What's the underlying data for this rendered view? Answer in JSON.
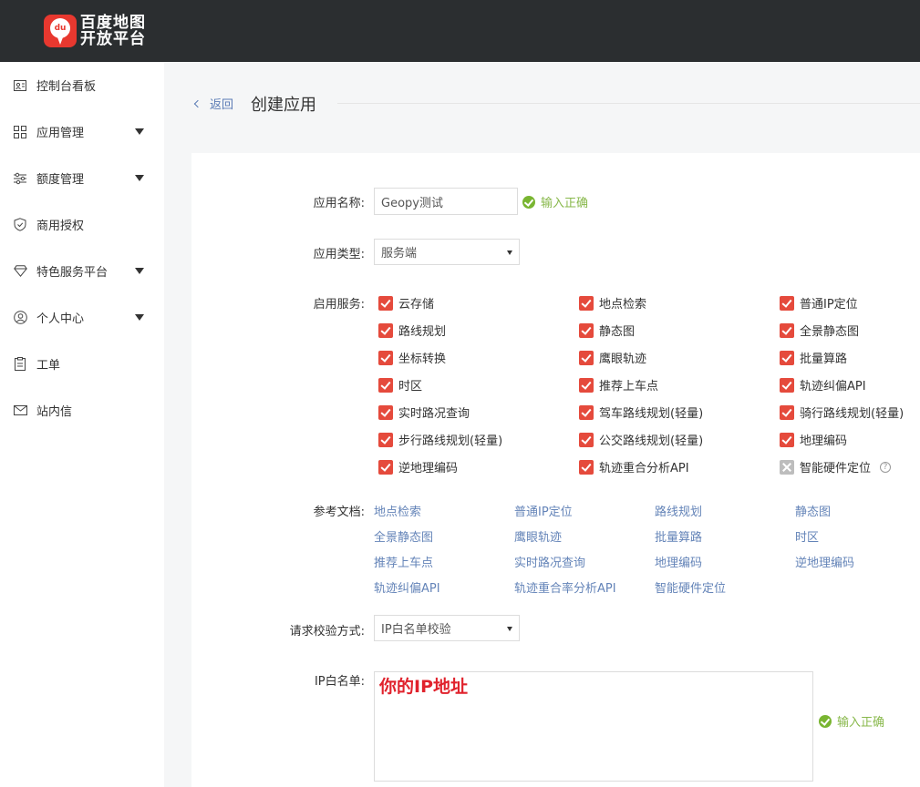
{
  "brand": {
    "line1": "百度地图",
    "line2": "开放平台",
    "badge": "du"
  },
  "sidebar": {
    "items": [
      {
        "label": "控制台看板",
        "icon": "dashboard-icon",
        "dropdown": false
      },
      {
        "label": "应用管理",
        "icon": "grid-icon",
        "dropdown": true
      },
      {
        "label": "额度管理",
        "icon": "sliders-icon",
        "dropdown": true
      },
      {
        "label": "商用授权",
        "icon": "shield-check-icon",
        "dropdown": false
      },
      {
        "label": "特色服务平台",
        "icon": "diamond-icon",
        "dropdown": true
      },
      {
        "label": "个人中心",
        "icon": "user-icon",
        "dropdown": true
      },
      {
        "label": "工单",
        "icon": "clipboard-icon",
        "dropdown": false
      },
      {
        "label": "站内信",
        "icon": "mail-icon",
        "dropdown": false
      }
    ]
  },
  "header": {
    "back_label": "返回",
    "title": "创建应用"
  },
  "form": {
    "app_name": {
      "label": "应用名称:",
      "value": "Geopy测试",
      "status": "输入正确"
    },
    "app_type": {
      "label": "应用类型:",
      "value": "服务端"
    },
    "services": {
      "label": "启用服务:",
      "items": [
        {
          "label": "云存储",
          "checked": true
        },
        {
          "label": "地点检索",
          "checked": true
        },
        {
          "label": "普通IP定位",
          "checked": true
        },
        {
          "label": "路线规划",
          "checked": true
        },
        {
          "label": "静态图",
          "checked": true
        },
        {
          "label": "全景静态图",
          "checked": true
        },
        {
          "label": "坐标转换",
          "checked": true
        },
        {
          "label": "鹰眼轨迹",
          "checked": true
        },
        {
          "label": "批量算路",
          "checked": true
        },
        {
          "label": "时区",
          "checked": true
        },
        {
          "label": "推荐上车点",
          "checked": true
        },
        {
          "label": "轨迹纠偏API",
          "checked": true
        },
        {
          "label": "实时路况查询",
          "checked": true
        },
        {
          "label": "驾车路线规划(轻量)",
          "checked": true
        },
        {
          "label": "骑行路线规划(轻量)",
          "checked": true
        },
        {
          "label": "步行路线规划(轻量)",
          "checked": true
        },
        {
          "label": "公交路线规划(轻量)",
          "checked": true
        },
        {
          "label": "地理编码",
          "checked": true
        },
        {
          "label": "逆地理编码",
          "checked": true
        },
        {
          "label": "轨迹重合分析API",
          "checked": true
        },
        {
          "label": "智能硬件定位",
          "checked": false
        }
      ],
      "help_mark": "?"
    },
    "docs": {
      "label": "参考文档:",
      "links": [
        "地点检索",
        "普通IP定位",
        "路线规划",
        "静态图",
        "全景静态图",
        "鹰眼轨迹",
        "批量算路",
        "时区",
        "推荐上车点",
        "实时路况查询",
        "地理编码",
        "逆地理编码",
        "轨迹纠偏API",
        "轨迹重合率分析API",
        "智能硬件定位"
      ]
    },
    "verify": {
      "label": "请求校验方式:",
      "value": "IP白名单校验"
    },
    "whitelist": {
      "label": "IP白名单:",
      "overlay_text": "你的IP地址",
      "status": "输入正确"
    }
  }
}
